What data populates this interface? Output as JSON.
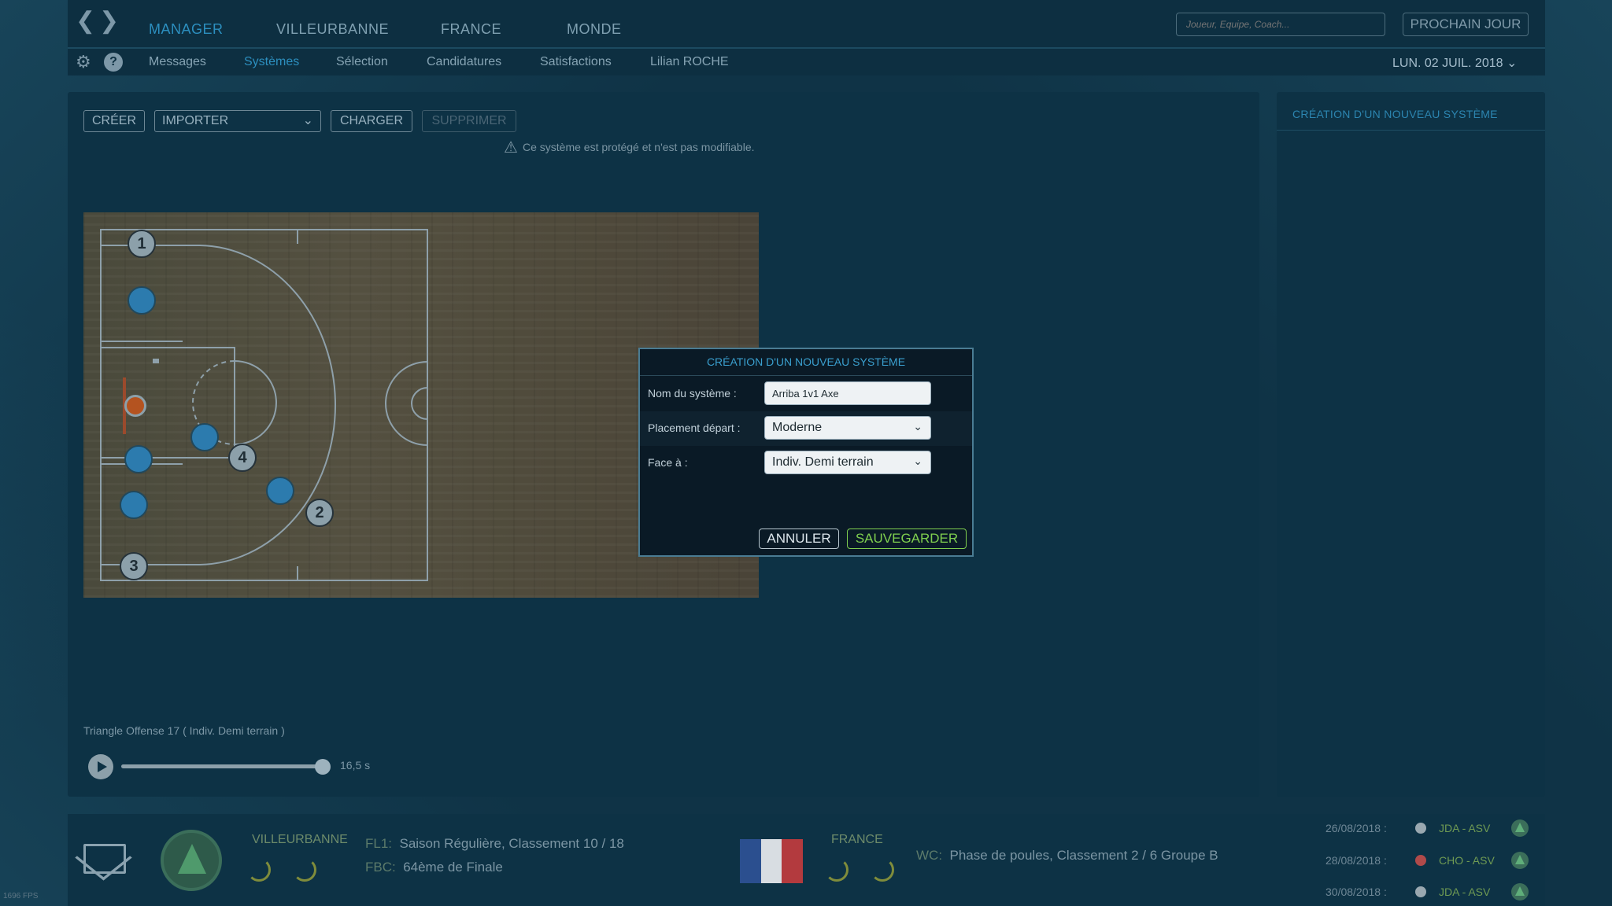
{
  "top_nav": {
    "items": [
      "MANAGER",
      "VILLEURBANNE",
      "FRANCE",
      "MONDE"
    ],
    "active": "MANAGER",
    "search_placeholder": "Joueur, Equipe, Coach...",
    "next_day_label": "PROCHAIN JOUR"
  },
  "sub_nav": {
    "items": [
      "Messages",
      "Systèmes",
      "Sélection",
      "Candidatures",
      "Satisfactions",
      "Lilian ROCHE"
    ],
    "active": "Systèmes",
    "date": "LUN. 02 JUIL. 2018"
  },
  "toolbar": {
    "create_label": "CRÉER",
    "import_label": "IMPORTER",
    "load_label": "CHARGER",
    "delete_label": "SUPPRIMER"
  },
  "warning_text": "Ce système est protégé et n'est pas modifiable.",
  "court": {
    "markers": [
      "1",
      "2",
      "3",
      "4"
    ]
  },
  "system_caption": "Triangle Offense 17  ( Indiv. Demi terrain )",
  "playback": {
    "time_label": "16,5 s",
    "progress": 1.0
  },
  "side_panel": {
    "title": "CRÉATION D'UN NOUVEAU SYSTÈME"
  },
  "dialog": {
    "title": "CRÉATION D'UN NOUVEAU SYSTÈME",
    "name_label": "Nom du système :",
    "name_value": "Arriba 1v1 Axe",
    "placement_label": "Placement départ :",
    "placement_value": "Moderne",
    "face_label": "Face à :",
    "face_value": "Indiv. Demi terrain",
    "cancel_label": "ANNULER",
    "save_label": "SAUVEGARDER"
  },
  "bottom": {
    "club_name": "VILLEURBANNE",
    "club_lines": [
      {
        "code": "FL1:",
        "text": "Saison Régulière, Classement 10 / 18"
      },
      {
        "code": "FBC:",
        "text": "64ème de Finale"
      }
    ],
    "country_name": "FRANCE",
    "country_line": {
      "code": "WC:",
      "text": "Phase de poules, Classement 2 / 6 Groupe B"
    },
    "fixtures": [
      {
        "date": "26/08/2018 :",
        "match": "JDA - ASV"
      },
      {
        "date": "28/08/2018 :",
        "match": "CHO - ASV"
      },
      {
        "date": "30/08/2018 :",
        "match": "JDA - ASV"
      }
    ]
  },
  "fps": "1696 FPS",
  "colors": {
    "accent": "#2c8fbf",
    "save": "#7fcf4f",
    "player": "#2c7bae"
  }
}
